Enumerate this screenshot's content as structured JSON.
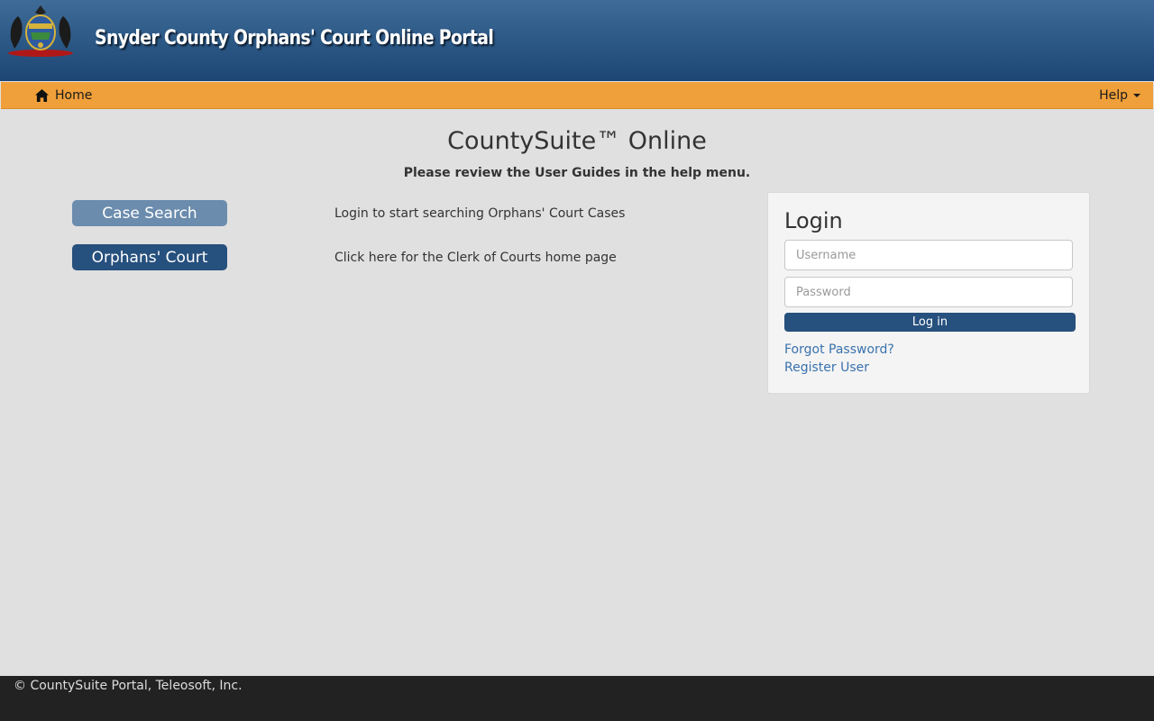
{
  "header": {
    "title": "Snyder County Orphans' Court Online Portal"
  },
  "nav": {
    "home_label": "Home",
    "help_label": "Help"
  },
  "main": {
    "title": "CountySuite™ Online",
    "subtitle": "Please review the User Guides in the help menu.",
    "links": [
      {
        "label": "Case Search",
        "description": "Login to start searching Orphans' Court Cases"
      },
      {
        "label": "Orphans' Court",
        "description": "Click here for the Clerk of Courts home page"
      }
    ]
  },
  "login": {
    "title": "Login",
    "username_placeholder": "Username",
    "password_placeholder": "Password",
    "submit_label": "Log in",
    "forgot_label": "Forgot Password?",
    "register_label": "Register User"
  },
  "footer": {
    "copyright": "© CountySuite Portal, Teleosoft, Inc."
  },
  "colors": {
    "header": "#2b5784",
    "navbar": "#f0a03a",
    "primary_button": "#26507d",
    "muted_button": "#6b8cad",
    "link": "#3a72ad",
    "footer": "#222222"
  },
  "icons": {
    "seal": "pennsylvania-seal-icon",
    "home": "home-icon",
    "help_dropdown": "caret-down-icon"
  }
}
